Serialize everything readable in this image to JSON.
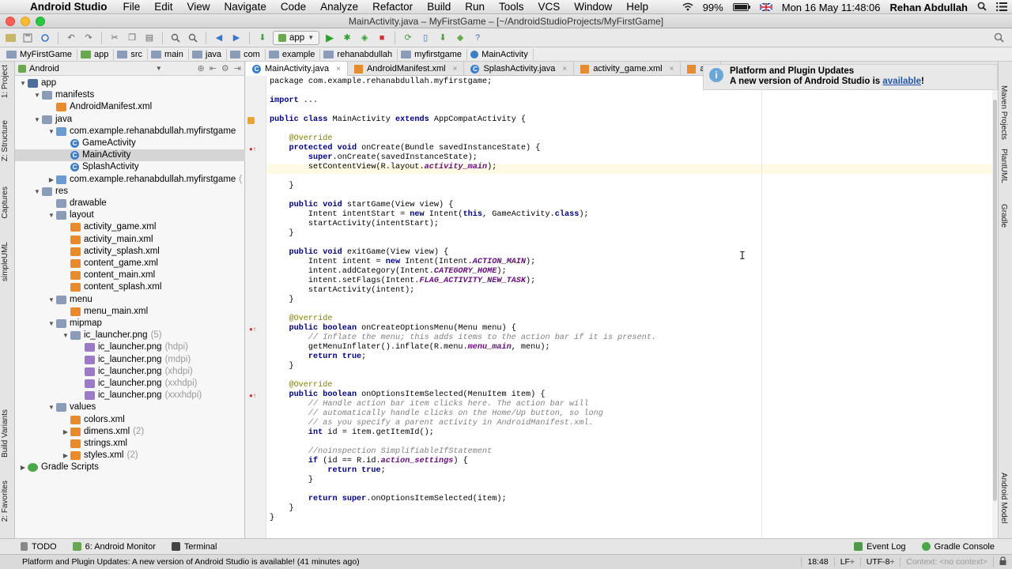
{
  "macos_menubar": {
    "app_name": "Android Studio",
    "menus": [
      "File",
      "Edit",
      "View",
      "Navigate",
      "Code",
      "Analyze",
      "Refactor",
      "Build",
      "Run",
      "Tools",
      "VCS",
      "Window",
      "Help"
    ],
    "battery": "99%",
    "datetime": "Mon 16 May  11:48:06",
    "user": "Rehan Abdullah"
  },
  "window": {
    "title": "MainActivity.java – MyFirstGame – [~/AndroidStudioProjects/MyFirstGame]"
  },
  "toolbar": {
    "run_config": "app"
  },
  "breadcrumb": [
    "MyFirstGame",
    "app",
    "src",
    "main",
    "java",
    "com",
    "example",
    "rehanabdullah",
    "myfirstgame",
    "MainActivity"
  ],
  "project_panel": {
    "view_mode": "Android",
    "tree": [
      {
        "label": "app",
        "icon": "module-folder",
        "expanded": true,
        "depth": 0
      },
      {
        "label": "manifests",
        "icon": "folder",
        "expanded": true,
        "depth": 1
      },
      {
        "label": "AndroidManifest.xml",
        "icon": "manifest",
        "depth": 2
      },
      {
        "label": "java",
        "icon": "folder",
        "expanded": true,
        "depth": 1
      },
      {
        "label": "com.example.rehanabdullah.myfirstgame",
        "icon": "package",
        "expanded": true,
        "depth": 2
      },
      {
        "label": "GameActivity",
        "icon": "class",
        "depth": 3
      },
      {
        "label": "MainActivity",
        "icon": "class",
        "depth": 3,
        "selected": true
      },
      {
        "label": "SplashActivity",
        "icon": "class",
        "depth": 3
      },
      {
        "label": "com.example.rehanabdullah.myfirstgame",
        "extra": "(",
        "icon": "package",
        "expanded": false,
        "depth": 2
      },
      {
        "label": "res",
        "icon": "folder",
        "expanded": true,
        "depth": 1
      },
      {
        "label": "drawable",
        "icon": "folder",
        "depth": 2
      },
      {
        "label": "layout",
        "icon": "folder",
        "expanded": true,
        "depth": 2
      },
      {
        "label": "activity_game.xml",
        "icon": "xml",
        "depth": 3
      },
      {
        "label": "activity_main.xml",
        "icon": "xml",
        "depth": 3
      },
      {
        "label": "activity_splash.xml",
        "icon": "xml",
        "depth": 3
      },
      {
        "label": "content_game.xml",
        "icon": "xml",
        "depth": 3
      },
      {
        "label": "content_main.xml",
        "icon": "xml",
        "depth": 3
      },
      {
        "label": "content_splash.xml",
        "icon": "xml",
        "depth": 3
      },
      {
        "label": "menu",
        "icon": "folder",
        "expanded": true,
        "depth": 2
      },
      {
        "label": "menu_main.xml",
        "icon": "xml",
        "depth": 3
      },
      {
        "label": "mipmap",
        "icon": "folder",
        "expanded": true,
        "depth": 2
      },
      {
        "label": "ic_launcher.png",
        "extra": "(5)",
        "icon": "folder",
        "expanded": true,
        "depth": 3
      },
      {
        "label": "ic_launcher.png",
        "extra": "(hdpi)",
        "icon": "image",
        "depth": 4
      },
      {
        "label": "ic_launcher.png",
        "extra": "(mdpi)",
        "icon": "image",
        "depth": 4
      },
      {
        "label": "ic_launcher.png",
        "extra": "(xhdpi)",
        "icon": "image",
        "depth": 4
      },
      {
        "label": "ic_launcher.png",
        "extra": "(xxhdpi)",
        "icon": "image",
        "depth": 4
      },
      {
        "label": "ic_launcher.png",
        "extra": "(xxxhdpi)",
        "icon": "image",
        "depth": 4
      },
      {
        "label": "values",
        "icon": "folder",
        "expanded": true,
        "depth": 2
      },
      {
        "label": "colors.xml",
        "icon": "xml",
        "depth": 3
      },
      {
        "label": "dimens.xml",
        "extra": "(2)",
        "icon": "xml",
        "expanded": false,
        "depth": 3
      },
      {
        "label": "strings.xml",
        "icon": "xml",
        "depth": 3
      },
      {
        "label": "styles.xml",
        "extra": "(2)",
        "icon": "xml",
        "expanded": false,
        "depth": 3
      },
      {
        "label": "Gradle Scripts",
        "icon": "gradle",
        "expanded": false,
        "depth": 0
      }
    ]
  },
  "left_tool_tabs": [
    "1: Project",
    "Z: Structure",
    "Captures",
    "simpleUML",
    "Build Variants",
    "2: Favorites"
  ],
  "right_tool_tabs": [
    "Maven Projects",
    "PlantUML",
    "Gradle",
    "Android Model"
  ],
  "editor_tabs": [
    {
      "label": "MainActivity.java",
      "icon": "class",
      "active": true
    },
    {
      "label": "AndroidManifest.xml",
      "icon": "manifest"
    },
    {
      "label": "SplashActivity.java",
      "icon": "class"
    },
    {
      "label": "activity_game.xml",
      "icon": "xml"
    },
    {
      "label": "acti",
      "icon": "xml"
    }
  ],
  "code_lines": [
    [
      [
        "package com.example.rehanabdullah.myfirstgame;",
        "p"
      ]
    ],
    [],
    [
      [
        "import",
        "k"
      ],
      [
        " ...",
        "p"
      ]
    ],
    [],
    [
      [
        "public class",
        "k"
      ],
      [
        " MainActivity ",
        "p"
      ],
      [
        "extends",
        "k"
      ],
      [
        " AppCompatActivity {",
        "p"
      ]
    ],
    [],
    [
      [
        "    @Override",
        "a"
      ]
    ],
    [
      [
        "    ",
        "p"
      ],
      [
        "protected void",
        "k"
      ],
      [
        " onCreate(Bundle savedInstanceState) {",
        "p"
      ]
    ],
    [
      [
        "        ",
        "p"
      ],
      [
        "super",
        "k"
      ],
      [
        ".onCreate(savedInstanceState);",
        "p"
      ]
    ],
    [
      [
        "        setContentView(R.layout.",
        "p"
      ],
      [
        "activity_main",
        "s"
      ],
      [
        ");",
        "p"
      ]
    ],
    [],
    [
      [
        "    }",
        "p"
      ]
    ],
    [],
    [
      [
        "    ",
        "p"
      ],
      [
        "public void",
        "k"
      ],
      [
        " startGame(View view) {",
        "p"
      ]
    ],
    [
      [
        "        Intent intentStart = ",
        "p"
      ],
      [
        "new",
        "k"
      ],
      [
        " Intent(",
        "p"
      ],
      [
        "this",
        "k"
      ],
      [
        ", GameActivity.",
        "p"
      ],
      [
        "class",
        "k"
      ],
      [
        ");",
        "p"
      ]
    ],
    [
      [
        "        startActivity(intentStart);",
        "p"
      ]
    ],
    [
      [
        "    }",
        "p"
      ]
    ],
    [],
    [
      [
        "    ",
        "p"
      ],
      [
        "public void",
        "k"
      ],
      [
        " exitGame(View view) {",
        "p"
      ]
    ],
    [
      [
        "        Intent intent = ",
        "p"
      ],
      [
        "new",
        "k"
      ],
      [
        " Intent(Intent.",
        "p"
      ],
      [
        "ACTION_MAIN",
        "s"
      ],
      [
        ");",
        "p"
      ]
    ],
    [
      [
        "        intent.addCategory(Intent.",
        "p"
      ],
      [
        "CATEGORY_HOME",
        "s"
      ],
      [
        ");",
        "p"
      ]
    ],
    [
      [
        "        intent.setFlags(Intent.",
        "p"
      ],
      [
        "FLAG_ACTIVITY_NEW_TASK",
        "s"
      ],
      [
        ");",
        "p"
      ]
    ],
    [
      [
        "        startActivity(intent);",
        "p"
      ]
    ],
    [
      [
        "    }",
        "p"
      ]
    ],
    [],
    [
      [
        "    @Override",
        "a"
      ]
    ],
    [
      [
        "    ",
        "p"
      ],
      [
        "public boolean",
        "k"
      ],
      [
        " onCreateOptionsMenu(Menu menu) {",
        "p"
      ]
    ],
    [
      [
        "        // Inflate the menu; this adds items to the action bar if it is present.",
        "c"
      ]
    ],
    [
      [
        "        getMenuInflater().inflate(R.menu.",
        "p"
      ],
      [
        "menu_main",
        "s"
      ],
      [
        ", menu);",
        "p"
      ]
    ],
    [
      [
        "        ",
        "p"
      ],
      [
        "return true",
        "k"
      ],
      [
        ";",
        "p"
      ]
    ],
    [
      [
        "    }",
        "p"
      ]
    ],
    [],
    [
      [
        "    @Override",
        "a"
      ]
    ],
    [
      [
        "    ",
        "p"
      ],
      [
        "public boolean",
        "k"
      ],
      [
        " onOptionsItemSelected(MenuItem item) {",
        "p"
      ]
    ],
    [
      [
        "        // Handle action bar item clicks here. The action bar will",
        "c"
      ]
    ],
    [
      [
        "        // automatically handle clicks on the Home/Up button, so long",
        "c"
      ]
    ],
    [
      [
        "        // as you specify a parent activity in AndroidManifest.xml.",
        "c"
      ]
    ],
    [
      [
        "        ",
        "p"
      ],
      [
        "int",
        "k"
      ],
      [
        " id = item.getItemId();",
        "p"
      ]
    ],
    [],
    [
      [
        "        //noinspection SimplifiableIfStatement",
        "c"
      ]
    ],
    [
      [
        "        ",
        "p"
      ],
      [
        "if",
        "k"
      ],
      [
        " (id == R.id.",
        "p"
      ],
      [
        "action_settings",
        "s"
      ],
      [
        ") {",
        "p"
      ]
    ],
    [
      [
        "            ",
        "p"
      ],
      [
        "return true",
        "k"
      ],
      [
        ";",
        "p"
      ]
    ],
    [
      [
        "        }",
        "p"
      ]
    ],
    [],
    [
      [
        "        ",
        "p"
      ],
      [
        "return super",
        "k"
      ],
      [
        ".onOptionsItemSelected(item);",
        "p"
      ]
    ],
    [
      [
        "    }",
        "p"
      ]
    ],
    [
      [
        "}",
        "p"
      ]
    ]
  ],
  "notification": {
    "title": "Platform and Plugin Updates",
    "body_prefix": "A new version of Android Studio is ",
    "link": "available",
    "body_suffix": "!"
  },
  "bottom_tools": {
    "left": [
      "TODO",
      "6: Android Monitor",
      "Terminal"
    ],
    "right": [
      "Event Log",
      "Gradle Console"
    ]
  },
  "status_bar": {
    "message": "Platform and Plugin Updates: A new version of Android Studio is available! (41 minutes ago)",
    "position": "18:48",
    "line_sep": "LF÷",
    "encoding": "UTF-8÷",
    "context": "Context: <no context>"
  },
  "colors": {
    "keyword": "#000080",
    "annotation": "#808000",
    "comment": "#808080",
    "static_field": "#660e7a",
    "selection": "#d5d5d5"
  }
}
